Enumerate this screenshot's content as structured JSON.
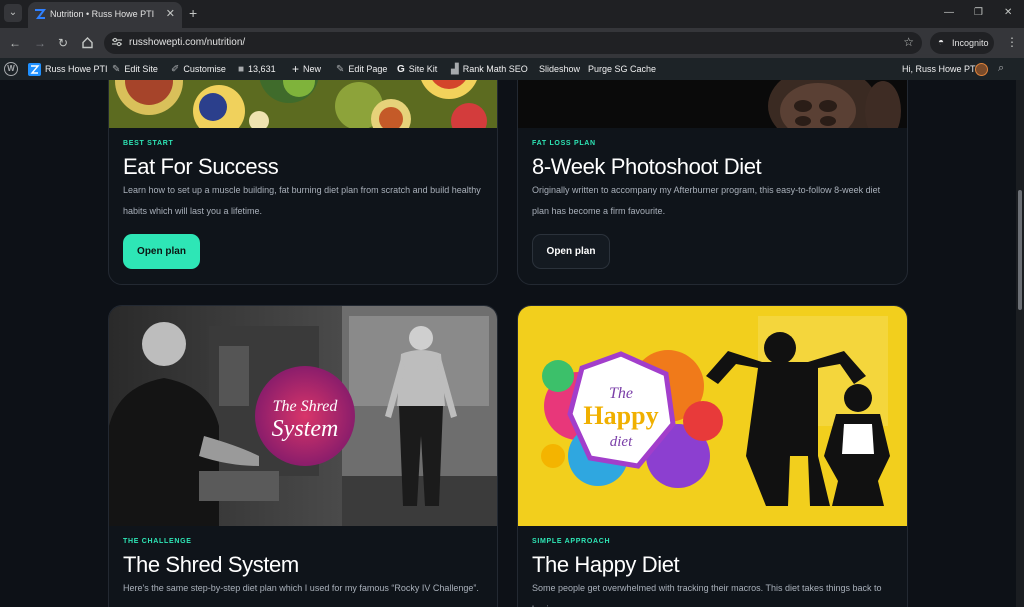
{
  "browser": {
    "tab": {
      "title": "Nutrition • Russ Howe PTI",
      "close": "✕"
    },
    "new_tab": "+",
    "window_controls": {
      "minimize": "—",
      "restore": "❐",
      "close": "✕"
    },
    "url": "russhowepti.com/nutrition/",
    "incognito_label": "Incognito"
  },
  "admin_bar": {
    "site_name": "Russ Howe PTI",
    "edit_site": "Edit Site",
    "customise": "Customise",
    "comments_count": "13,631",
    "new": "New",
    "edit_page": "Edit Page",
    "site_kit": "Site Kit",
    "rank_math": "Rank Math SEO",
    "slideshow": "Slideshow",
    "purge_cache": "Purge SG Cache",
    "greeting": "Hi, Russ Howe PTI"
  },
  "plans": [
    {
      "kicker": "BEST START",
      "title": "Eat For Success",
      "description": "Learn how to set up a muscle building, fat burning diet plan from scratch and build healthy habits which will last you a lifetime.",
      "button": "Open plan"
    },
    {
      "kicker": "FAT LOSS PLAN",
      "title": "8-Week Photoshoot Diet",
      "description": "Originally written to accompany my Afterburner program, this easy-to-follow 8-week diet plan has become a firm favourite.",
      "button": "Open plan"
    },
    {
      "kicker": "THE CHALLENGE",
      "title": "The Shred System",
      "description": "Here's the same step-by-step diet plan which I used for my famous “Rocky IV Challenge”.",
      "image_text": [
        "The Shred",
        "System"
      ]
    },
    {
      "kicker": "SIMPLE APPROACH",
      "title": "The Happy Diet",
      "description": "Some people get overwhelmed with tracking their macros. This diet takes things back to basics.",
      "image_text": [
        "The",
        "Happy",
        "diet"
      ]
    }
  ],
  "colors": {
    "accent": "#2ee6b6",
    "page_bg": "#0d1117",
    "card_bg": "#0f141a",
    "happy_yellow": "#f2cf1d"
  }
}
